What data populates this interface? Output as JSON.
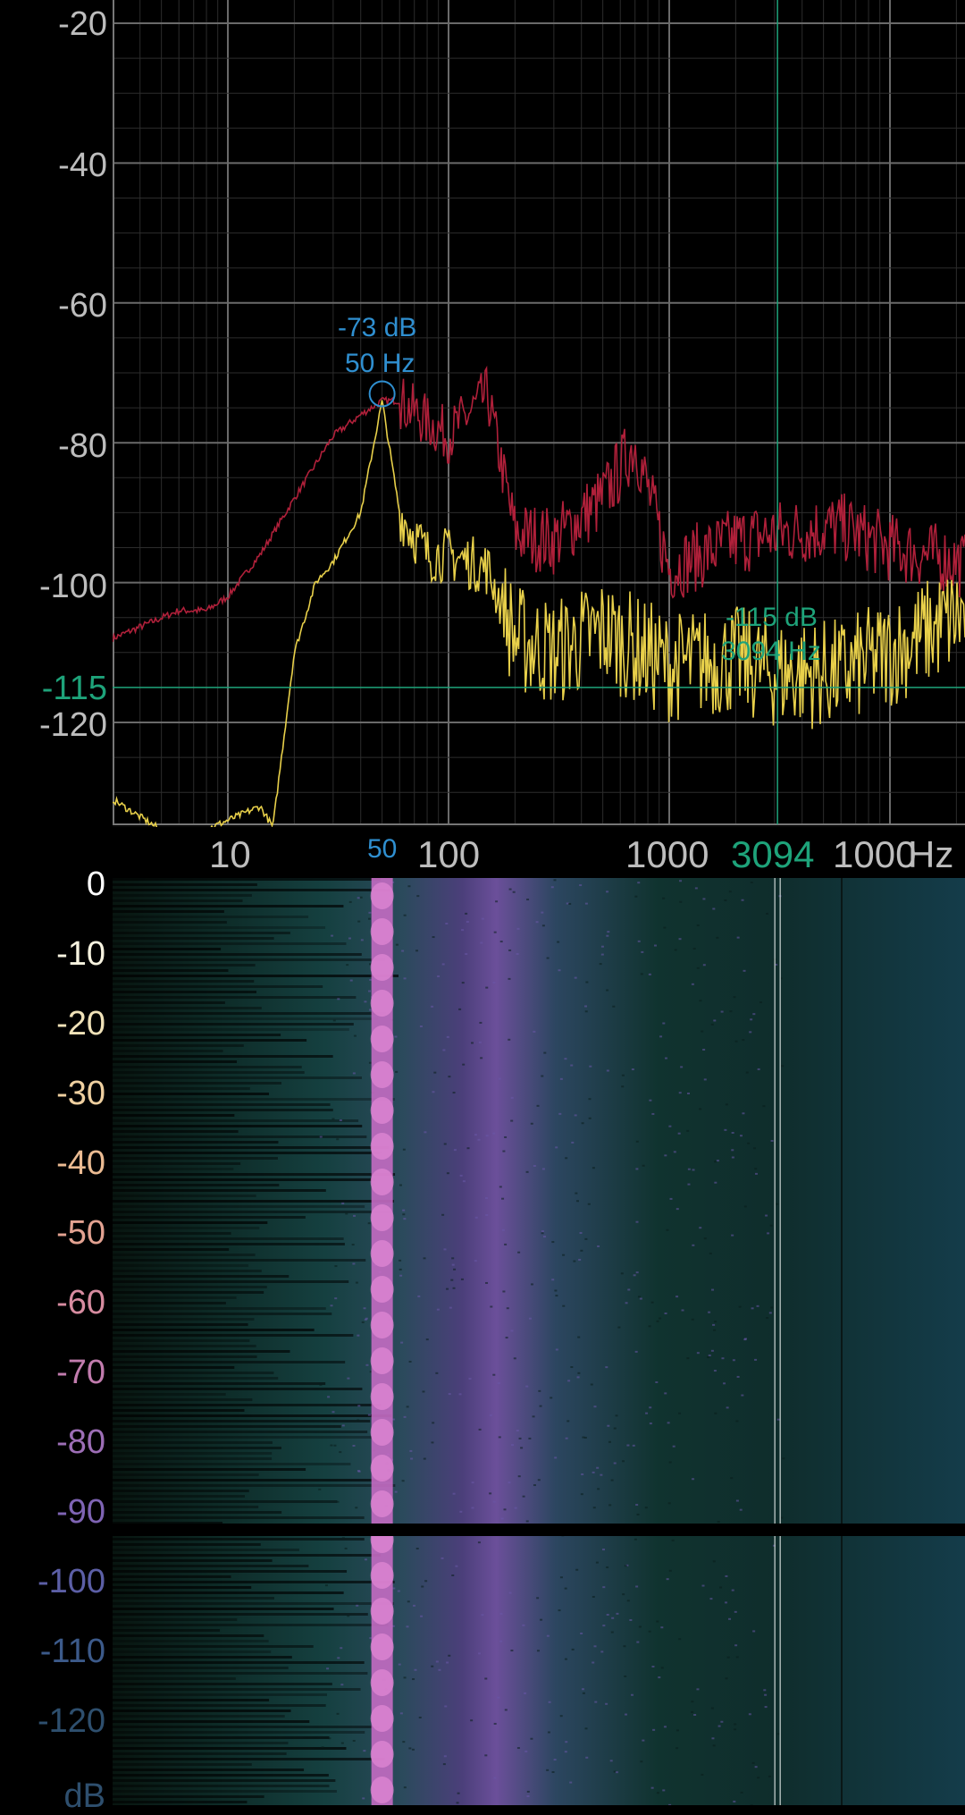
{
  "spectrum": {
    "y_labels": [
      "-20",
      "-40",
      "-60",
      "-80",
      "-100",
      "-120"
    ],
    "cursor_y_label": "-115",
    "x_labels": [
      "10",
      "100",
      "1000",
      "1000"
    ],
    "unit_label": "Hz",
    "cursor_x_label": "3094",
    "peak_freq_tick": "50",
    "peak_marker": {
      "db": "-73 dB",
      "hz": "50 Hz"
    },
    "cursor_marker": {
      "db": "-115 dB",
      "hz": "3094 Hz"
    },
    "colors": {
      "grid": "#3a3a3a",
      "axis_text": "#bdbdbd",
      "peak": "#2f8fd0",
      "cursor": "#1ea37a",
      "peak_hold": "#b0203a",
      "live": "#e8d04a"
    }
  },
  "spectrogram": {
    "labels": [
      "0",
      "-10",
      "-20",
      "-30",
      "-40",
      "-50",
      "-60",
      "-70",
      "-80",
      "-90",
      "-100",
      "-110",
      "-120"
    ],
    "unit_label": "dB",
    "label_colors": [
      "#ffffff",
      "#f7f3e0",
      "#f0e2b8",
      "#efd0a0",
      "#ebbb92",
      "#e3a291",
      "#d78ca0",
      "#c27cae",
      "#9d6eb6",
      "#7f64b4",
      "#5c5fa6",
      "#3c5a8a",
      "#2e4f6e"
    ]
  }
}
